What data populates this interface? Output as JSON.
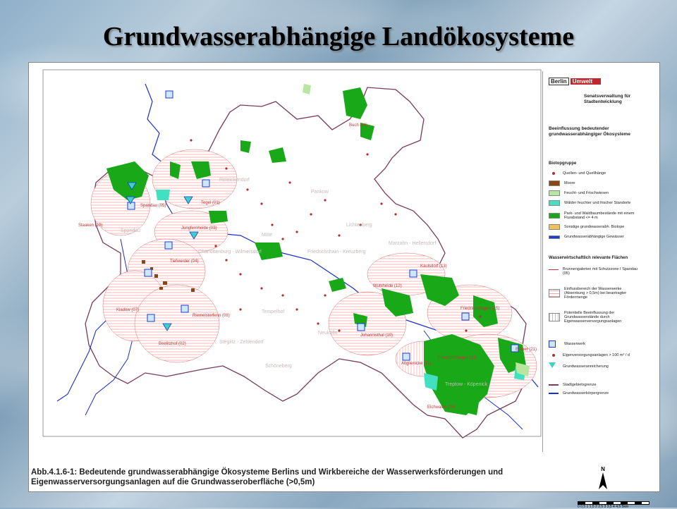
{
  "slide": {
    "title": "Grundwasserabhängige Landökosysteme"
  },
  "legend": {
    "logo_berlin": "Berlin",
    "logo_umwelt": "Umwelt",
    "agency": "Senatsverwaltung für Stadtentwicklung",
    "map_title": "Beeinflussung bedeutender grundwasserabhängiger Ökosysteme",
    "group_biotop": "Biotopgruppe",
    "items_biotop": [
      {
        "label": "Quellen- und Quellhänge",
        "color": "#b03030"
      },
      {
        "label": "Moore",
        "color": "#8b4513"
      },
      {
        "label": "Feucht- und Frischwiesen",
        "color": "#b8e6a0"
      },
      {
        "label": "Wälder feuchter und frischer Standorte",
        "color": "#40e0c0"
      },
      {
        "label": "Park- und Waldbaumbestände mit einem Flurabstand <= 4 m",
        "color": "#1aa61a"
      },
      {
        "label": "Sonstige grundwasserabh. Biotope",
        "color": "#f0c060"
      },
      {
        "label": "Grundwasserabhängige Gewässer",
        "color": "#1a3ccf"
      }
    ],
    "group_areas": "Wasserwirtschaftlich relevante Flächen",
    "items_areas": [
      {
        "label": "Brunnengalerien mit Schutzzone I Spandau (05)"
      },
      {
        "label": "Einflussbereich der Wasserwerke (Absenkung > 0,5m) bei beantragter Fördermenge"
      },
      {
        "label": "Potentielle Beeinflussung der Grundwasserstände durch Eigenwasserversorgungsanlagen"
      },
      {
        "label": "Wasserwerk"
      },
      {
        "label": "Eigenversorgungsanlagen > 100 m³ / d"
      },
      {
        "label": "Grundwasseranreicherung"
      },
      {
        "label": "Stadtgebietsgrenze"
      },
      {
        "label": "Grundwasserkörpergrenze"
      }
    ],
    "north": "N",
    "scale": "0 0,5 1 1,5 2 2,5 3 3,5 4 4,5 5km"
  },
  "map": {
    "districts": [
      "Reinickendorf",
      "Pankow",
      "Lichtenberg",
      "Marzahn - Hellersdorf",
      "Mitte",
      "Charlottenburg - Wilmersdorf",
      "Friedrichshain - Kreuzberg",
      "Spandau",
      "Tempelhof",
      "Neukölln",
      "Steglitz - Zehlendorf",
      "Schöneberg",
      "Treptow - Köpenick"
    ],
    "waterworks": [
      "Spandau (05)",
      "Tegel (01)",
      "Jungfernheide (03)",
      "Tiefwerder (04)",
      "Kladow (07)",
      "Riemeisterfenn (08)",
      "Beelitzhof (02)",
      "Buch (14)",
      "Kaulsdorf (13)",
      "Wuhlheide (12)",
      "Johannisthal (10)",
      "Friedrichshagen (15)",
      "Altglienicke (11)",
      "Stolpe (16)",
      "Eichwalde (26)",
      "Staaken (19)",
      "Friedrichshagen (11)",
      "Erkner (21)"
    ]
  },
  "caption": {
    "line1": "Abb.4.1.6-1: Bedeutende grundwasserabhängige Ökosysteme Berlins und Wirkbereiche der Wasserwerksförderungen und",
    "line2": "Eigenwasserversorgungsanlagen auf die Grundwasseroberfläche (>0,5m)"
  }
}
